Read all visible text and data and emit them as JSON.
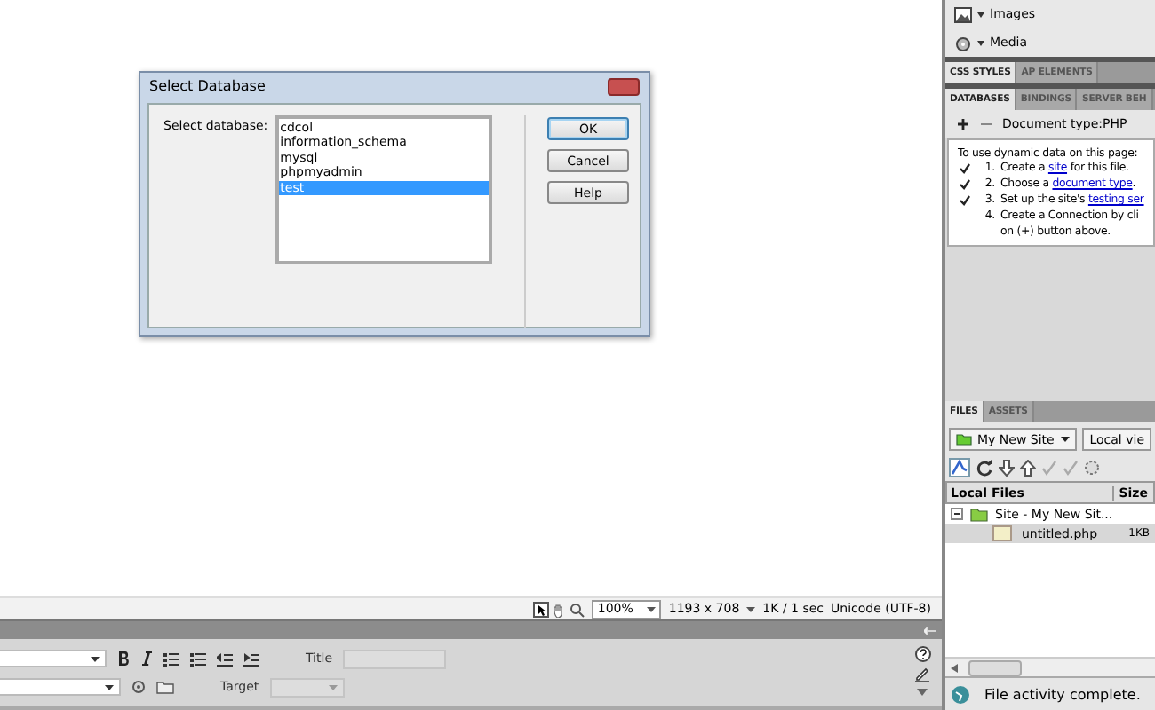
{
  "dialog": {
    "title": "Select Database",
    "label": "Select database:",
    "items": [
      {
        "text": "cdcol",
        "selected": false
      },
      {
        "text": "information_schema",
        "selected": false
      },
      {
        "text": "mysql",
        "selected": false
      },
      {
        "text": "phpmyadmin",
        "selected": false
      },
      {
        "text": "test",
        "selected": true
      }
    ],
    "buttons": [
      {
        "label": "OK",
        "default": true
      },
      {
        "label": "Cancel",
        "default": false
      },
      {
        "label": "Help",
        "default": false
      }
    ]
  },
  "status_bar": {
    "zoom": "100%",
    "dimensions": "1193 x 708",
    "download": "1K / 1 sec",
    "encoding": "Unicode (UTF-8)"
  },
  "properties": {
    "title_label": "Title",
    "target_label": "Target"
  },
  "insert_panel": {
    "items": [
      "Images",
      "Media"
    ]
  },
  "panel_tabs": [
    {
      "label": "CSS STYLES",
      "selected": true
    },
    {
      "label": "AP ELEMENTS",
      "selected": false
    }
  ],
  "data_tabs": [
    {
      "label": "DATABASES",
      "selected": true
    },
    {
      "label": "BINDINGS",
      "selected": false
    },
    {
      "label": "SERVER BEH",
      "selected": false
    }
  ],
  "document_type": "Document type:PHP",
  "instructions": {
    "intro": "To use dynamic data on this page:",
    "steps": [
      {
        "number": "1.",
        "text": "Create a ",
        "link": "site",
        "after": " for this file.",
        "done": true
      },
      {
        "number": "2.",
        "text": "Choose a ",
        "link": "document type",
        "after": ".",
        "done": true
      },
      {
        "number": "3.",
        "text": "Set up the site's ",
        "link": "testing ser",
        "done": true
      },
      {
        "number": "4.",
        "text": "Create a Connection by cli",
        "line_2": "on (+) button above.",
        "done": false
      }
    ]
  },
  "files_tabs": [
    {
      "label": "FILES",
      "selected": true
    },
    {
      "label": "ASSETS",
      "selected": false
    }
  ],
  "site_select": "My New Site",
  "view_select": "Local vie",
  "files_columns": [
    "Local Files",
    "Size"
  ],
  "files_tree": [
    {
      "name": "Site - My New Sit...",
      "expanded": true,
      "children": [
        {
          "name": "untitled.php",
          "size": "1KB",
          "selected": true
        }
      ]
    }
  ],
  "files_status": "File activity complete."
}
